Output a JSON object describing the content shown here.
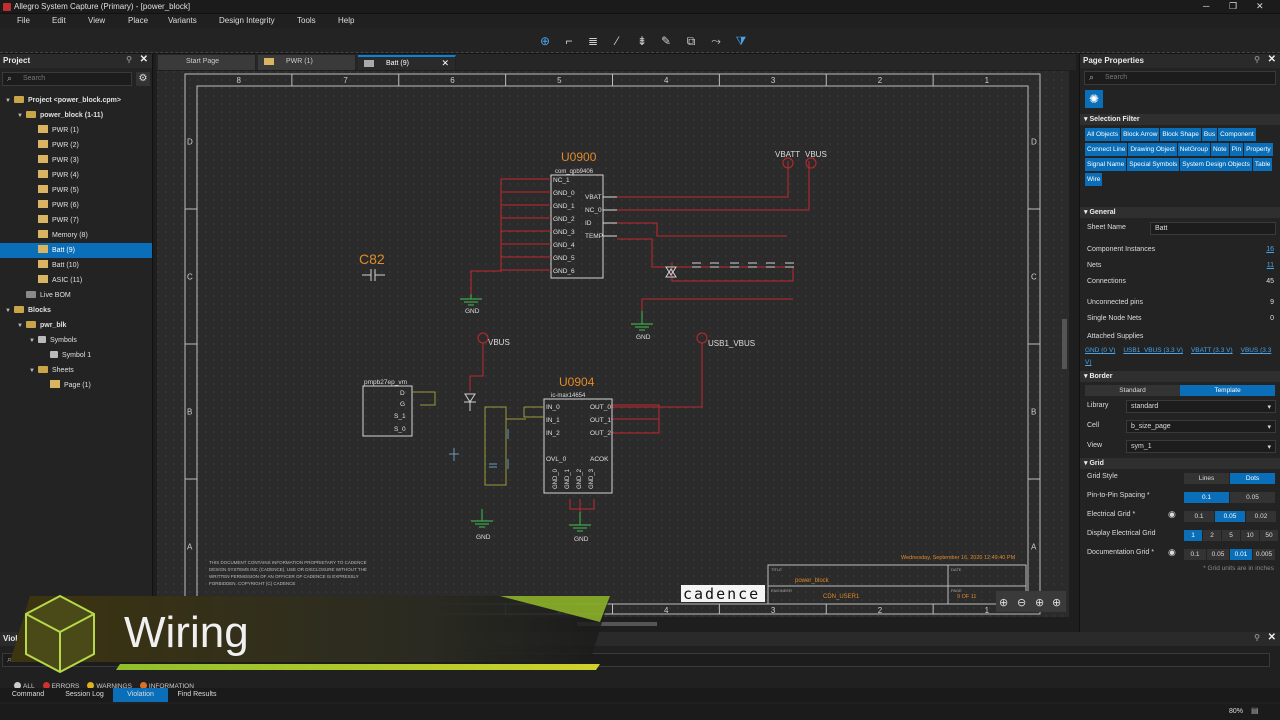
{
  "window": {
    "title": "Allegro System Capture (Primary) - [power_block]"
  },
  "menu": [
    "File",
    "Edit",
    "View",
    "Place",
    "Variants",
    "Design Integrity",
    "Tools",
    "Help"
  ],
  "project_panel": {
    "title": "Project",
    "search_placeholder": "Search",
    "tree": [
      {
        "label": "Project <power_block.cpm>",
        "level": 0,
        "kind": "project"
      },
      {
        "label": "power_block (1-11)",
        "level": 1,
        "kind": "folder"
      },
      {
        "label": "PWR (1)",
        "level": 2,
        "kind": "page"
      },
      {
        "label": "PWR (2)",
        "level": 2,
        "kind": "page"
      },
      {
        "label": "PWR (3)",
        "level": 2,
        "kind": "page"
      },
      {
        "label": "PWR (4)",
        "level": 2,
        "kind": "page"
      },
      {
        "label": "PWR (5)",
        "level": 2,
        "kind": "page"
      },
      {
        "label": "PWR (6)",
        "level": 2,
        "kind": "page"
      },
      {
        "label": "PWR (7)",
        "level": 2,
        "kind": "page"
      },
      {
        "label": "Memory (8)",
        "level": 2,
        "kind": "page"
      },
      {
        "label": "Batt (9)",
        "level": 2,
        "kind": "page",
        "selected": true
      },
      {
        "label": "Batt (10)",
        "level": 2,
        "kind": "page"
      },
      {
        "label": "ASIC (11)",
        "level": 2,
        "kind": "page"
      },
      {
        "label": "Live BOM",
        "level": 1,
        "kind": "bom"
      },
      {
        "label": "Blocks",
        "level": 0,
        "kind": "folder"
      },
      {
        "label": "pwr_blk",
        "level": 1,
        "kind": "folder"
      },
      {
        "label": "Symbols",
        "level": 2,
        "kind": "symbols"
      },
      {
        "label": "Symbol 1",
        "level": 3,
        "kind": "symbol"
      },
      {
        "label": "Sheets",
        "level": 2,
        "kind": "folder"
      },
      {
        "label": "Page (1)",
        "level": 3,
        "kind": "page"
      }
    ]
  },
  "tabs": [
    {
      "label": "Start Page",
      "active": false
    },
    {
      "label": "PWR (1)",
      "active": false
    },
    {
      "label": "Batt (9)",
      "active": true
    }
  ],
  "schematic": {
    "col_labels": [
      "8",
      "7",
      "6",
      "5",
      "4",
      "3",
      "2",
      "1"
    ],
    "row_labels": [
      "D",
      "C",
      "B",
      "A"
    ],
    "u0900": {
      "ref": "U0900",
      "part": "com_qpb9406",
      "left_pins": [
        "NC_1",
        "GND_0",
        "GND_1",
        "GND_2",
        "GND_3",
        "GND_4",
        "GND_5",
        "GND_6"
      ],
      "right_pins": [
        "VBAT",
        "NC_0",
        "ID",
        "TEMP"
      ]
    },
    "u0904": {
      "ref": "U0904",
      "part": "ic-max14654",
      "left_pins": [
        "IN_0",
        "IN_1",
        "IN_2",
        "OVL_0"
      ],
      "right_pins": [
        "OUT_0",
        "OUT_1",
        "OUT_2",
        "ACOK"
      ],
      "bottom_pins": [
        "GND_0",
        "GND_1",
        "GND_2",
        "GND_3"
      ]
    },
    "c82": "C82",
    "pmp": {
      "part": "pmpb27ep_vm",
      "pins": [
        "D",
        "G",
        "S_1",
        "S_0"
      ]
    },
    "nets": {
      "vbatt": "VBATT",
      "vbus": "VBUS",
      "usb1_vbus": "USB1_VBUS",
      "gnd": "GND"
    },
    "footer_text": "THIS DOCUMENT CONTAINS INFORMATION PROPRIETARY TO CADENCE DESIGN SYSTEMS INC (CADENCE). USE OR DISCLOSURE WITHOUT THE WRITTEN PERMISSION OF AN OFFICER OF CADENCE IS EXPRESSLY FORBIDDEN. COPYRIGHT (C) CADENCE",
    "date_stamp": "Wednesday, September 16, 2020 12:49:40 PM",
    "titleblock": {
      "title_label": "TITLE",
      "title": "power_block",
      "engineer_label": "ENGINEER",
      "engineer": "CDN_USER1",
      "date_label": "DATE",
      "page_label": "PAGE",
      "page": "9 OF 11",
      "logo": "cadence"
    }
  },
  "page_properties": {
    "title": "Page Properties",
    "search_placeholder": "Search",
    "selection_filter": {
      "title": "Selection Filter",
      "chips": [
        "All Objects",
        "Block Arrow",
        "Block Shape",
        "Bus",
        "Component",
        "Connect Line",
        "Drawing Object",
        "NetGroup",
        "Note",
        "Pin",
        "Property",
        "Signal Name",
        "Special Symbols",
        "System Design Objects",
        "Table",
        "Wire"
      ]
    },
    "general": {
      "title": "General",
      "sheet_name_label": "Sheet Name",
      "sheet_name": "Batt",
      "rows": [
        {
          "label": "Component Instances",
          "value": "16",
          "link": true
        },
        {
          "label": "Nets",
          "value": "11",
          "link": true
        },
        {
          "label": "Connections",
          "value": "45",
          "link": false
        },
        {
          "label": "Unconnected pins",
          "value": "9",
          "link": false
        },
        {
          "label": "Single Node Nets",
          "value": "0",
          "link": false
        }
      ],
      "supplies_label": "Attached Supplies",
      "supplies": [
        "GND (0 V)",
        "USB1_VBUS (3.3 V)",
        "VBATT (3.3 V)",
        "VBUS (3.3 V)"
      ]
    },
    "border": {
      "title": "Border",
      "modes": [
        "Standard",
        "Template"
      ],
      "active_mode": "Template",
      "library_label": "Library",
      "library": "standard",
      "cell_label": "Cell",
      "cell": "b_size_page",
      "view_label": "View",
      "view": "sym_1"
    },
    "grid": {
      "title": "Grid",
      "style_label": "Grid Style",
      "styles": [
        "Lines",
        "Dots"
      ],
      "active_style": "Dots",
      "pin_label": "Pin-to-Pin Spacing *",
      "pin_values": [
        "0.1",
        "0.05"
      ],
      "pin_active": "0.1",
      "elec_label": "Electrical Grid *",
      "elec_values": [
        "0.1",
        "0.05",
        "0.02"
      ],
      "elec_active": "0.05",
      "disp_label": "Display Electrical Grid",
      "disp_values": [
        "1",
        "2",
        "5",
        "10",
        "50"
      ],
      "disp_active": "1",
      "doc_label": "Documentation Grid *",
      "doc_values": [
        "0.1",
        "0.05",
        "0.01",
        "0.005"
      ],
      "doc_active": "0.01",
      "note": "* Grid units are in inches"
    }
  },
  "violations": {
    "title": "Violations",
    "search_placeholder": "Search",
    "filters": [
      "ALL",
      "ERRORS",
      "WARNINGS",
      "INFORMATION"
    ]
  },
  "bottom_tabs": [
    "Command",
    "Session Log",
    "Violation",
    "Find Results"
  ],
  "active_bottom_tab": "Violation",
  "zoom": "80%",
  "overlay_caption": "Wiring"
}
